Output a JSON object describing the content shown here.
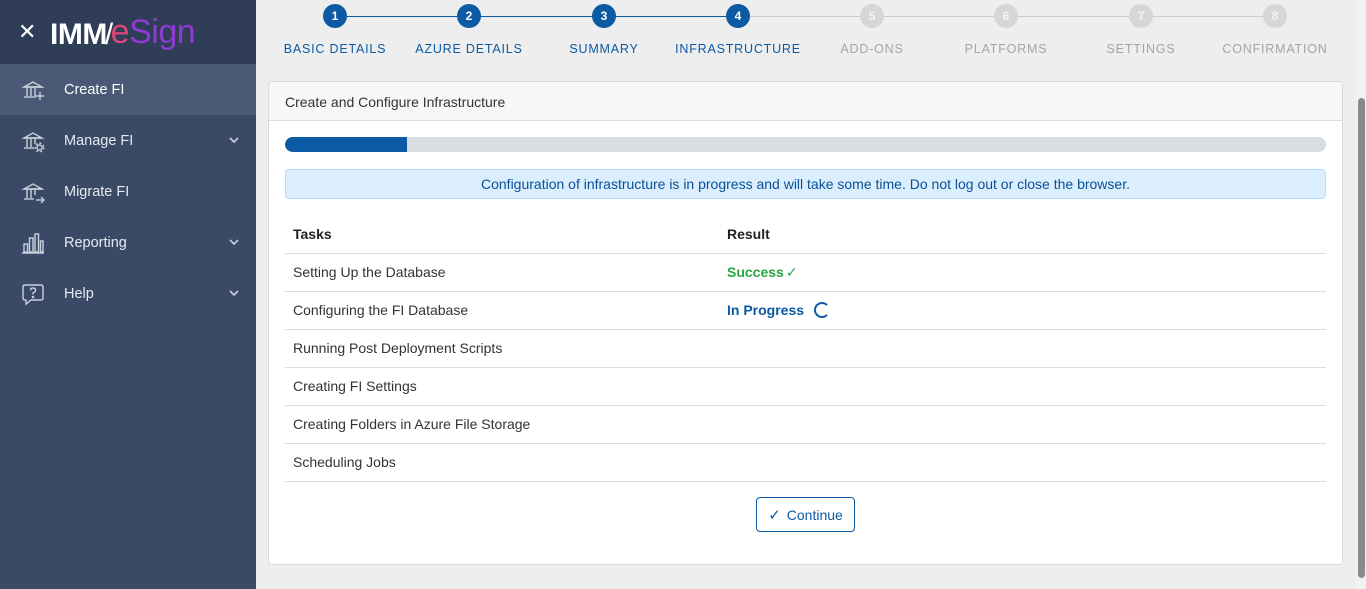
{
  "sidebar": {
    "logo": {
      "part1": "IMM",
      "part2": "/",
      "part3": "e",
      "part4": "Sign"
    },
    "items": [
      {
        "label": "Create FI",
        "icon": "bank-plus-icon",
        "active": true,
        "has_chevron": false
      },
      {
        "label": "Manage FI",
        "icon": "bank-gear-icon",
        "active": false,
        "has_chevron": true
      },
      {
        "label": "Migrate FI",
        "icon": "bank-arrow-icon",
        "active": false,
        "has_chevron": false
      },
      {
        "label": "Reporting",
        "icon": "bar-chart-icon",
        "active": false,
        "has_chevron": true
      },
      {
        "label": "Help",
        "icon": "help-bubble-icon",
        "active": false,
        "has_chevron": true
      }
    ]
  },
  "stepper": {
    "steps": [
      {
        "number": "1",
        "label": "BASIC DETAILS",
        "state": "done"
      },
      {
        "number": "2",
        "label": "AZURE DETAILS",
        "state": "done"
      },
      {
        "number": "3",
        "label": "SUMMARY",
        "state": "done"
      },
      {
        "number": "4",
        "label": "INFRASTRUCTURE",
        "state": "done"
      },
      {
        "number": "5",
        "label": "ADD-ONS",
        "state": "todo"
      },
      {
        "number": "6",
        "label": "PLATFORMS",
        "state": "todo"
      },
      {
        "number": "7",
        "label": "SETTINGS",
        "state": "todo"
      },
      {
        "number": "8",
        "label": "CONFIRMATION",
        "state": "todo"
      }
    ]
  },
  "card": {
    "title": "Create and Configure Infrastructure",
    "progress_fraction": 0.117,
    "alert": "Configuration of infrastructure is in progress and will take some time. Do not log out or close the browser.",
    "table": {
      "headers": {
        "task": "Tasks",
        "result": "Result"
      },
      "rows": [
        {
          "task": "Setting Up the Database",
          "result": "Success",
          "status": "success"
        },
        {
          "task": "Configuring the FI Database",
          "result": "In Progress",
          "status": "progress"
        },
        {
          "task": "Running Post Deployment Scripts",
          "result": "",
          "status": ""
        },
        {
          "task": "Creating FI Settings",
          "result": "",
          "status": ""
        },
        {
          "task": "Creating Folders in Azure File Storage",
          "result": "",
          "status": ""
        },
        {
          "task": "Scheduling Jobs",
          "result": "",
          "status": ""
        }
      ]
    },
    "continue_label": "Continue"
  },
  "colors": {
    "primary": "#0b5aa3",
    "success": "#28a745",
    "sidebar_bg": "#3a4a66",
    "alert_bg": "#dbeefe"
  }
}
